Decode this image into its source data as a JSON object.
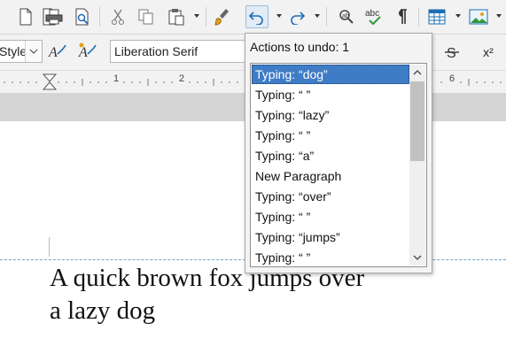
{
  "toolbar": {
    "icons": [
      "new-document-icon",
      "export-pdf-icon",
      "print-icon",
      "print-preview-icon",
      "cut-icon",
      "copy-icon",
      "paste-icon",
      "clone-formatting-icon",
      "undo-icon",
      "redo-icon",
      "find-replace-icon",
      "spelling-icon",
      "formatting-marks-icon",
      "table-icon",
      "image-icon"
    ]
  },
  "format_bar": {
    "paragraph_style": "Style",
    "font_name": "Liberation Serif",
    "superscript_label": "x²"
  },
  "ruler": {
    "numbers": [
      "1",
      "2",
      "6"
    ]
  },
  "undo_popup": {
    "title": "Actions to undo: 1",
    "items": [
      "Typing: “dog”",
      "Typing: “ ”",
      "Typing: “lazy”",
      "Typing: “ ”",
      "Typing: “a”",
      "New Paragraph",
      "Typing: “over”",
      "Typing: “ ”",
      "Typing: “jumps”",
      "Typing: “ ”"
    ],
    "selected_index": 0
  },
  "document": {
    "line1": "A quick brown fox jumps over",
    "line2": "a lazy dog"
  },
  "colors": {
    "selection": "#3f7cc6",
    "toolbar_bg": "#f2f2f2",
    "text_boundary": "#6fa6cf"
  }
}
